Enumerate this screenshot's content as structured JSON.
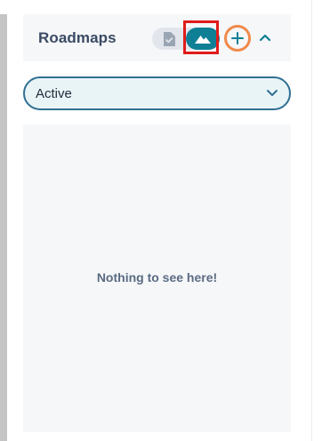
{
  "roadmaps_panel": {
    "title": "Roadmaps",
    "view_toggle": {
      "docs_icon": "document-check-icon",
      "roadmap_icon": "mountain-icon",
      "selected": "roadmap"
    },
    "add_icon": "plus-icon",
    "collapse_icon": "chevron-up-icon",
    "status_filter": {
      "value": "Active",
      "icon": "chevron-down-icon"
    },
    "empty_state": {
      "message": "Nothing to see here!"
    }
  },
  "colors": {
    "accent": "#0f7f95",
    "highlight_box": "#e01b1b",
    "add_ring": "#f08a4b",
    "select_border": "#2f6f93",
    "select_fill": "#e9f4f7",
    "panel_fill": "#f6f7f9"
  }
}
